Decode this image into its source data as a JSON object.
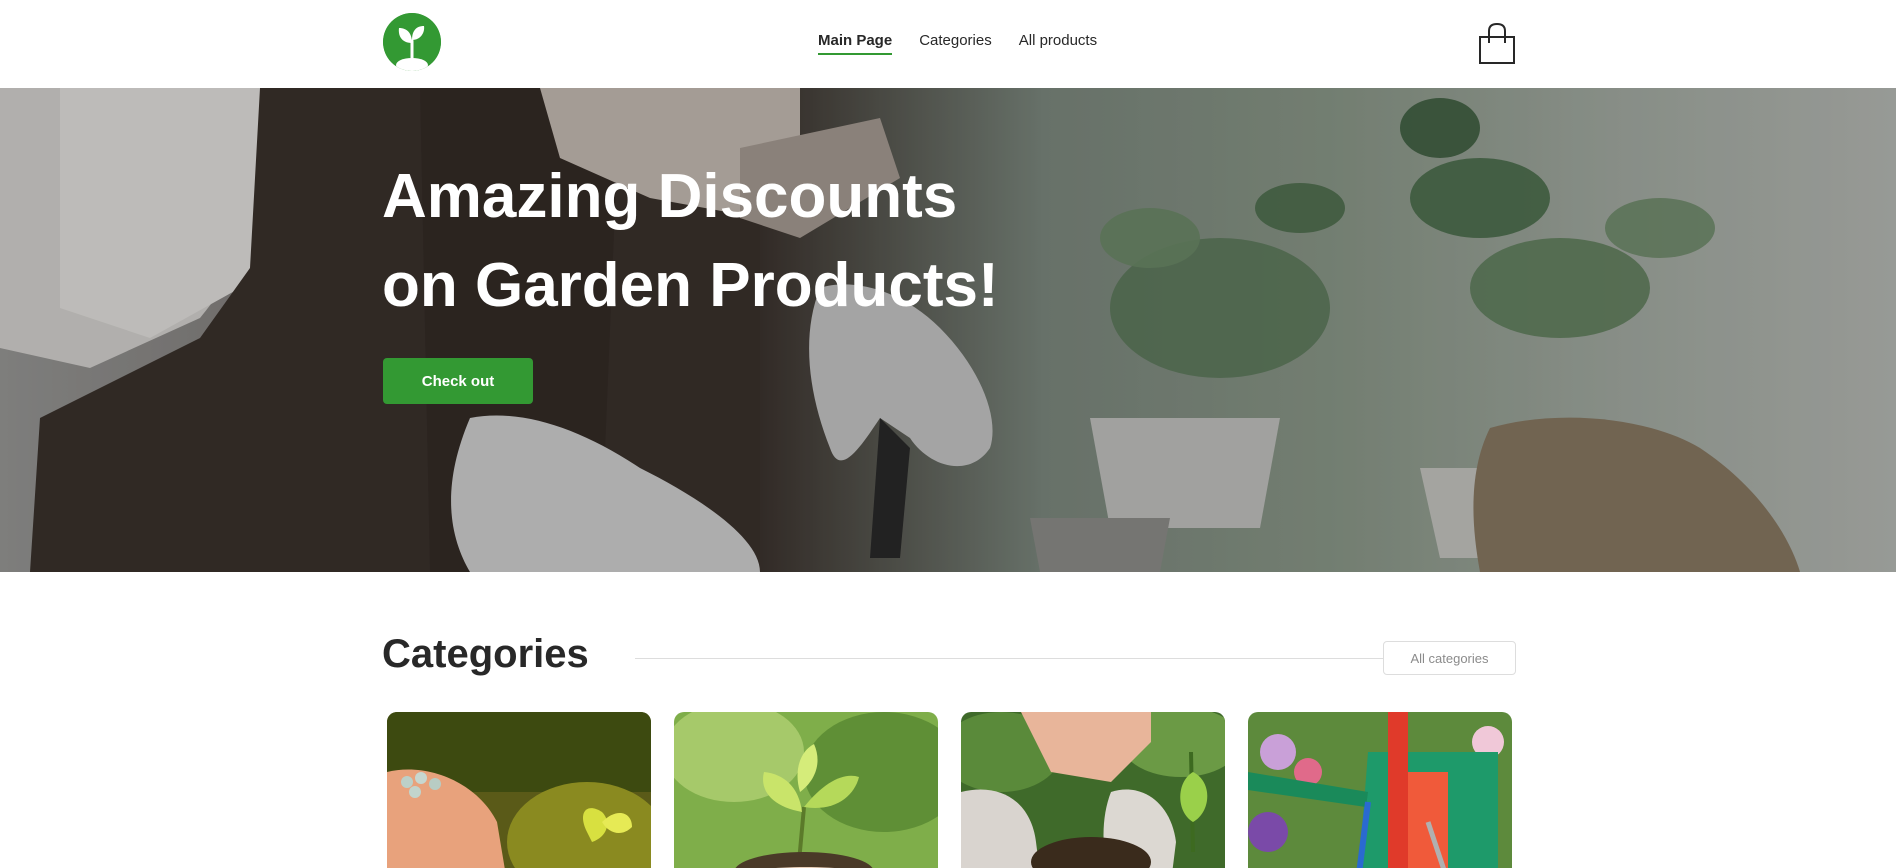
{
  "header": {
    "logo_icon": "sprout-logo-icon",
    "nav": [
      {
        "label": "Main Page",
        "active": true
      },
      {
        "label": "Categories",
        "active": false
      },
      {
        "label": "All products",
        "active": false
      }
    ],
    "cart_icon": "shopping-bag-icon"
  },
  "hero": {
    "title_line1": "Amazing Discounts",
    "title_line2": "on Garden Products!",
    "button_label": "Check out"
  },
  "categories": {
    "title": "Categories",
    "all_button_label": "All categories",
    "cards": [
      {
        "image": "fertilizer-hand-photo"
      },
      {
        "image": "seedling-in-soil-photo"
      },
      {
        "image": "planting-gloves-photo"
      },
      {
        "image": "garden-tools-watering-can-photo"
      }
    ]
  },
  "colors": {
    "accent": "#339933",
    "text": "#282828",
    "muted": "#8b8b8b",
    "divider": "#dddddd"
  }
}
